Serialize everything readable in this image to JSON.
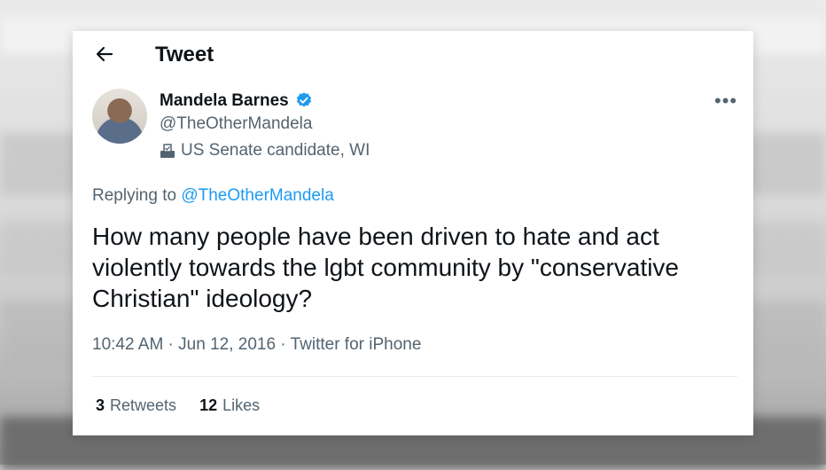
{
  "header": {
    "title": "Tweet"
  },
  "author": {
    "name": "Mandela Barnes",
    "handle": "@TheOtherMandela",
    "bio": "US Senate candidate, WI"
  },
  "reply": {
    "prefix": "Replying to ",
    "mention": "@TheOtherMandela"
  },
  "tweet": {
    "text": "How many people have been driven to hate and act violently towards the lgbt community by \"conservative Christian\" ideology?",
    "meta": "10:42 AM · Jun 12, 2016 · Twitter for iPhone"
  },
  "stats": {
    "retweets_count": "3",
    "retweets_label": "Retweets",
    "likes_count": "12",
    "likes_label": "Likes"
  },
  "colors": {
    "accent": "#1d9bf0",
    "text": "#0f1419",
    "muted": "#536471"
  },
  "icons": [
    "back-arrow-icon",
    "verified-badge-icon",
    "ballot-box-icon",
    "more-options-icon"
  ]
}
